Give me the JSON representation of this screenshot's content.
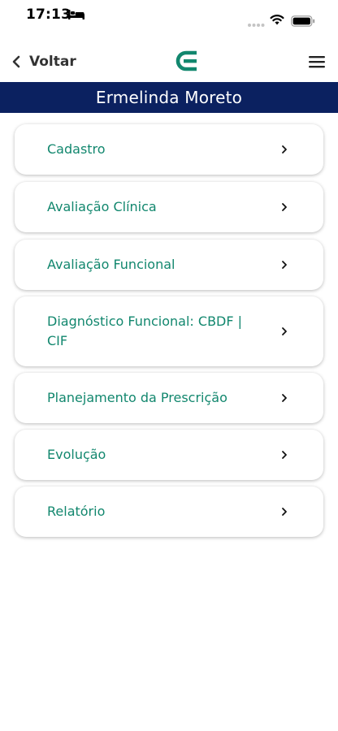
{
  "status_bar": {
    "time": "17:13",
    "icons": [
      "bed-icon",
      "cellular-signal-icon",
      "wifi-icon",
      "battery-icon"
    ]
  },
  "nav": {
    "back_label": "Voltar",
    "back_icon": "chevron-left-icon",
    "logo_icon": "app-logo-icon",
    "menu_icon": "hamburger-menu-icon"
  },
  "patient": {
    "name": "Ermelinda Moreto"
  },
  "menu": {
    "items": [
      {
        "label": "Cadastro"
      },
      {
        "label": "Avaliação Clínica"
      },
      {
        "label": "Avaliação Funcional"
      },
      {
        "label": "Diagnóstico Funcional: CBDF | CIF"
      },
      {
        "label": "Planejamento da Prescrição"
      },
      {
        "label": "Evolução"
      },
      {
        "label": "Relatório"
      }
    ],
    "chevron_icon": "chevron-right-icon"
  },
  "colors": {
    "accent": "#12876e",
    "header_bg": "#0b2160",
    "text_dark": "#333333"
  }
}
